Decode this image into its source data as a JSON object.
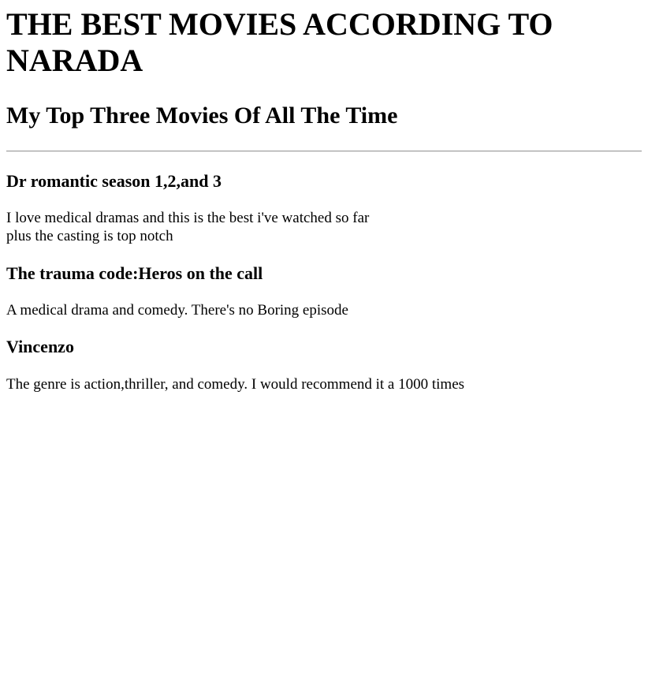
{
  "page": {
    "title": "THE BEST MOVIES ACCORDING TO NARADA",
    "subtitle": "My Top Three Movies Of All The Time"
  },
  "movies": [
    {
      "title": "Dr romantic season 1,2,and 3",
      "review_line1": "I love medical dramas and this is the best i've watched so far",
      "review_line2": "plus the casting is top notch"
    },
    {
      "title": "The trauma code:Heros on the call",
      "review_line1": "A medical drama and comedy. There's no Boring episode"
    },
    {
      "title": "Vincenzo",
      "review_line1": "The genre is action,thriller, and comedy. I would recommend it a 1000 times"
    }
  ]
}
